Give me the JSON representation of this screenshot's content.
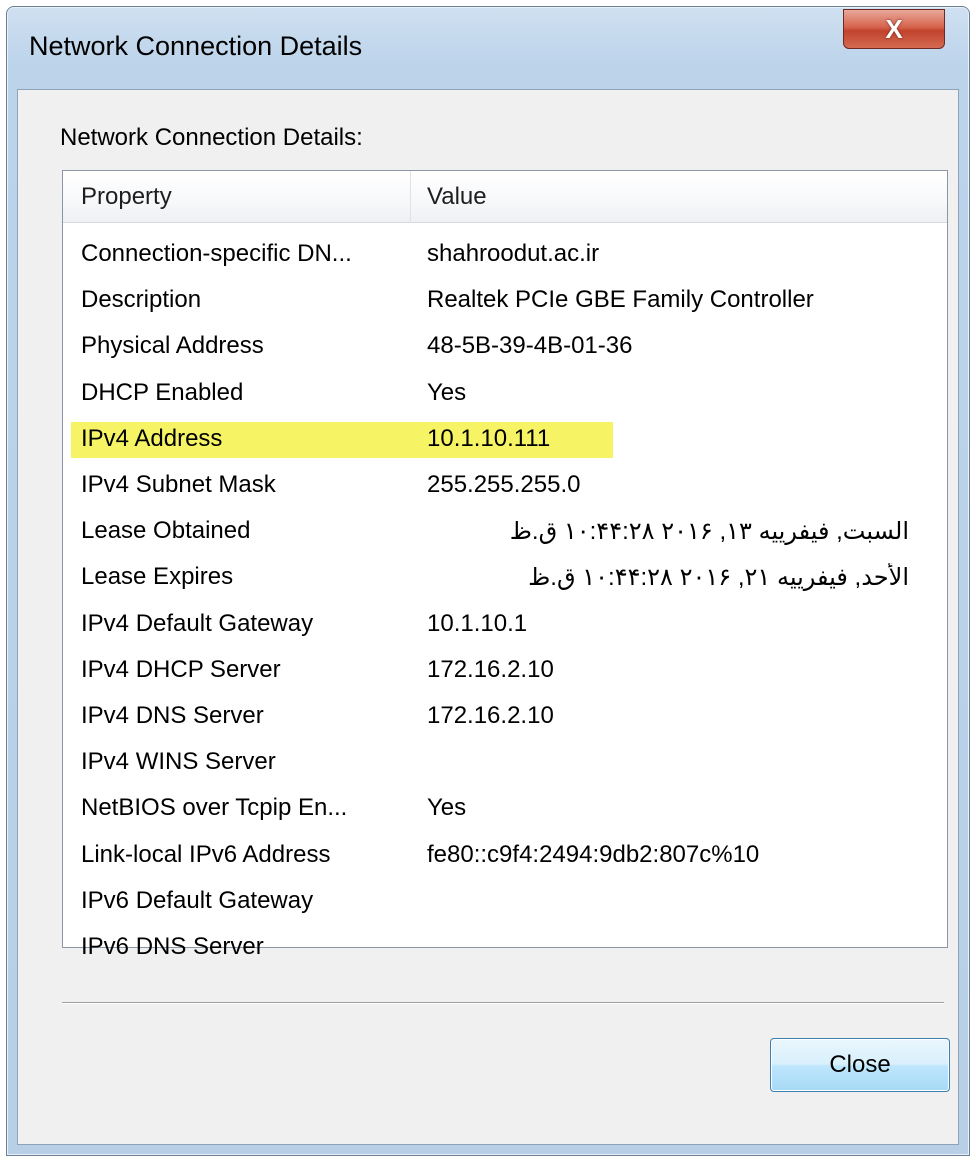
{
  "window": {
    "title": "Network Connection Details",
    "close_glyph": "X"
  },
  "group_label": "Network Connection Details:",
  "table": {
    "columns": [
      "Property",
      "Value"
    ],
    "rows": [
      {
        "property": "Connection-specific DN...",
        "value": "shahroodut.ac.ir"
      },
      {
        "property": "Description",
        "value": "Realtek PCIe GBE Family Controller"
      },
      {
        "property": "Physical Address",
        "value": "48-5B-39-4B-01-36"
      },
      {
        "property": "DHCP Enabled",
        "value": "Yes"
      },
      {
        "property": "IPv4 Address",
        "value": "10.1.10.111",
        "highlighted": true
      },
      {
        "property": "IPv4 Subnet Mask",
        "value": "255.255.255.0"
      },
      {
        "property": "Lease Obtained",
        "value": "السبت, فيفرييه ١٣, ٢٠١۶ ١٠:۴۴:٢٨ ق.ظ",
        "rtl": true
      },
      {
        "property": "Lease Expires",
        "value": "الأحد, فيفرييه ٢١, ٢٠١۶ ١٠:۴۴:٢٨ ق.ظ",
        "rtl": true
      },
      {
        "property": "IPv4 Default Gateway",
        "value": "10.1.10.1"
      },
      {
        "property": "IPv4 DHCP Server",
        "value": "172.16.2.10"
      },
      {
        "property": "IPv4 DNS Server",
        "value": "172.16.2.10"
      },
      {
        "property": "IPv4 WINS Server",
        "value": ""
      },
      {
        "property": "NetBIOS over Tcpip En...",
        "value": "Yes"
      },
      {
        "property": "Link-local IPv6 Address",
        "value": "fe80::c9f4:2494:9db2:807c%10"
      },
      {
        "property": "IPv6 Default Gateway",
        "value": ""
      },
      {
        "property": "IPv6 DNS Server",
        "value": ""
      }
    ]
  },
  "buttons": {
    "close_label": "Close"
  },
  "colors": {
    "highlight": "#f4f24a",
    "title_close_button": "#c2432c",
    "default_button_border": "#3c7fb1"
  }
}
